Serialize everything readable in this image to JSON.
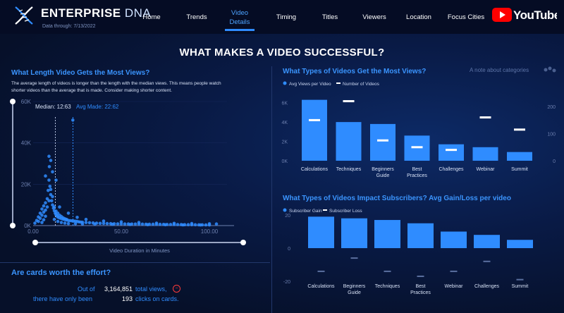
{
  "header": {
    "brand_main": "ENTERPRISE",
    "brand_sub": "DNA",
    "data_through": "Data through: 7/13/2022",
    "youtube_label": "YouTube"
  },
  "nav": [
    {
      "label": "Home"
    },
    {
      "label": "Trends"
    },
    {
      "label": "Video Details",
      "active": true
    },
    {
      "label": "Timing"
    },
    {
      "label": "Titles"
    },
    {
      "label": "Viewers"
    },
    {
      "label": "Location"
    },
    {
      "label": "Focus Cities"
    }
  ],
  "page_title": "WHAT MAKES A VIDEO SUCCESSFUL?",
  "length_section": {
    "heading": "What Length Video Gets the Most Views?",
    "description_1": "The average length of videos is longer than the length with the median views. This means people watch",
    "description_2": "shorter videos than the average that is made. Consider making shorter content.",
    "median_label": "Median: 12:63",
    "avg_label": "Avg Made: 22:62",
    "y_ticks": [
      "60K",
      "40K",
      "20K",
      "0K"
    ],
    "x_ticks": [
      "0.00",
      "50.00",
      "100.00"
    ],
    "x_axis_label": "Video Duration in Minutes"
  },
  "types_views_section": {
    "heading": "What Types of Videos Get the Most Views?",
    "note": "A note about categories",
    "legend_avg": "Avg Views per Video",
    "legend_num": "Number of Videos",
    "left_ticks": [
      "6K",
      "4K",
      "2K",
      "0K"
    ],
    "right_ticks": [
      "200",
      "100",
      "0"
    ]
  },
  "subscribers_section": {
    "heading": "What Types of Videos Impact Subscribers? Avg Gain/Loss per video",
    "legend_gain": "Subscriber Gain",
    "legend_loss": "Subscriber Loss",
    "ticks": [
      "20",
      "0",
      "-20"
    ]
  },
  "cards_section": {
    "heading": "Are cards worth the effort?",
    "row1_pre": "Out of",
    "row1_value": "3,164,851",
    "row1_post": "total views,",
    "row2_pre": "there have only been",
    "row2_value": "193",
    "row2_post": "clicks on cards."
  },
  "chart_data": [
    {
      "type": "scatter",
      "title": "What Length Video Gets the Most Views?",
      "xlabel": "Video Duration in Minutes",
      "ylabel": "",
      "xlim": [
        0,
        110
      ],
      "ylim": [
        0,
        60000
      ],
      "reference_lines": [
        {
          "name": "Median: 12:63",
          "x": 12.6
        },
        {
          "name": "Avg Made: 22:62",
          "x": 22.6
        }
      ],
      "points": [
        [
          1,
          1200
        ],
        [
          2,
          2500
        ],
        [
          3,
          4200
        ],
        [
          4,
          6000
        ],
        [
          5,
          8000
        ],
        [
          6,
          9500
        ],
        [
          7,
          11000
        ],
        [
          8,
          13000
        ],
        [
          8.5,
          17000
        ],
        [
          9,
          22000
        ],
        [
          9.2,
          28500
        ],
        [
          9.5,
          19000
        ],
        [
          10,
          15000
        ],
        [
          10.5,
          12000
        ],
        [
          11,
          10000
        ],
        [
          11.5,
          8500
        ],
        [
          12,
          7200
        ],
        [
          12.5,
          6000
        ],
        [
          13,
          5200
        ],
        [
          13.5,
          4700
        ],
        [
          14,
          4100
        ],
        [
          15,
          3700
        ],
        [
          16,
          3400
        ],
        [
          17,
          3100
        ],
        [
          18,
          2900
        ],
        [
          19,
          2700
        ],
        [
          20,
          2500
        ],
        [
          21,
          2400
        ],
        [
          22,
          2300
        ],
        [
          23,
          2200
        ],
        [
          24,
          2100
        ],
        [
          25,
          2000
        ],
        [
          22.5,
          51000
        ],
        [
          26,
          1800
        ],
        [
          27,
          1700
        ],
        [
          28,
          1600
        ],
        [
          30,
          1500
        ],
        [
          32,
          1400
        ],
        [
          34,
          1300
        ],
        [
          36,
          1200
        ],
        [
          38,
          1100
        ],
        [
          40,
          1050
        ],
        [
          42,
          1000
        ],
        [
          44,
          950
        ],
        [
          46,
          900
        ],
        [
          48,
          860
        ],
        [
          50,
          830
        ],
        [
          52,
          800
        ],
        [
          54,
          780
        ],
        [
          56,
          760
        ],
        [
          58,
          740
        ],
        [
          60,
          720
        ],
        [
          62,
          700
        ],
        [
          64,
          680
        ],
        [
          66,
          660
        ],
        [
          68,
          640
        ],
        [
          70,
          620
        ],
        [
          72,
          600
        ],
        [
          74,
          580
        ],
        [
          76,
          560
        ],
        [
          78,
          540
        ],
        [
          80,
          520
        ],
        [
          82,
          500
        ],
        [
          84,
          480
        ],
        [
          86,
          460
        ],
        [
          88,
          440
        ],
        [
          90,
          420
        ],
        [
          92,
          400
        ],
        [
          94,
          380
        ],
        [
          96,
          360
        ],
        [
          98,
          340
        ],
        [
          100,
          320
        ],
        [
          3,
          2000
        ],
        [
          4,
          3500
        ],
        [
          5,
          5000
        ],
        [
          6,
          6500
        ],
        [
          7,
          7500
        ],
        [
          8,
          9000
        ],
        [
          9,
          12000
        ],
        [
          10,
          17500
        ],
        [
          11,
          14000
        ],
        [
          12,
          9000
        ],
        [
          13,
          7000
        ],
        [
          14,
          6000
        ],
        [
          15,
          5000
        ],
        [
          16,
          4400
        ],
        [
          17,
          3800
        ],
        [
          18,
          3300
        ],
        [
          19,
          3000
        ],
        [
          5,
          1500
        ],
        [
          6,
          2800
        ],
        [
          7,
          4500
        ],
        [
          12,
          3000
        ],
        [
          14,
          2000
        ],
        [
          16,
          1500
        ],
        [
          18,
          1200
        ],
        [
          20,
          1000
        ],
        [
          24,
          900
        ],
        [
          28,
          800
        ],
        [
          35,
          700
        ],
        [
          45,
          600
        ],
        [
          55,
          500
        ],
        [
          65,
          450
        ],
        [
          75,
          400
        ],
        [
          85,
          350
        ],
        [
          95,
          300
        ],
        [
          7,
          24000
        ],
        [
          10,
          31500
        ],
        [
          13,
          22000
        ],
        [
          11,
          26000
        ],
        [
          9,
          33500
        ],
        [
          15,
          9000
        ],
        [
          20,
          6000
        ],
        [
          25,
          4000
        ],
        [
          30,
          3000
        ],
        [
          40,
          2200
        ],
        [
          50,
          1800
        ],
        [
          60,
          1500
        ],
        [
          70,
          1200
        ],
        [
          80,
          1100
        ],
        [
          90,
          1000
        ],
        [
          100,
          900
        ],
        [
          104,
          800
        ]
      ]
    },
    {
      "type": "bar",
      "title": "What Types of Videos Get the Most Views?",
      "categories": [
        "Calculations",
        "Techniques",
        "Beginners Guide",
        "Best Practices",
        "Challenges",
        "Webinar",
        "Summit"
      ],
      "series": [
        {
          "name": "Avg Views per Video",
          "values": [
            6300,
            4000,
            3800,
            2600,
            1700,
            1400,
            900
          ],
          "axis": "left"
        },
        {
          "name": "Number of Videos",
          "values": [
            150,
            220,
            75,
            50,
            40,
            160,
            115
          ],
          "axis": "right"
        }
      ],
      "ylim": [
        0,
        7000
      ],
      "y2lim": [
        0,
        250
      ]
    },
    {
      "type": "bar",
      "title": "What Types of Videos Impact Subscribers? Avg Gain/Loss per video",
      "categories": [
        "Calculations",
        "Beginners Guide",
        "Techniques",
        "Best Practices",
        "Webinar",
        "Challenges",
        "Summit"
      ],
      "series": [
        {
          "name": "Subscriber Gain",
          "values": [
            19,
            18,
            17,
            15,
            10,
            8,
            5
          ]
        },
        {
          "name": "Subscriber Loss",
          "values": [
            -14,
            -6,
            -14,
            -17,
            -14,
            -8,
            -19
          ]
        }
      ],
      "ylim": [
        -25,
        25
      ]
    }
  ],
  "colors": {
    "accent": "#2f8cff",
    "bar": "#2f8cff",
    "background": "#071230",
    "youtube_red": "#ff0000"
  }
}
